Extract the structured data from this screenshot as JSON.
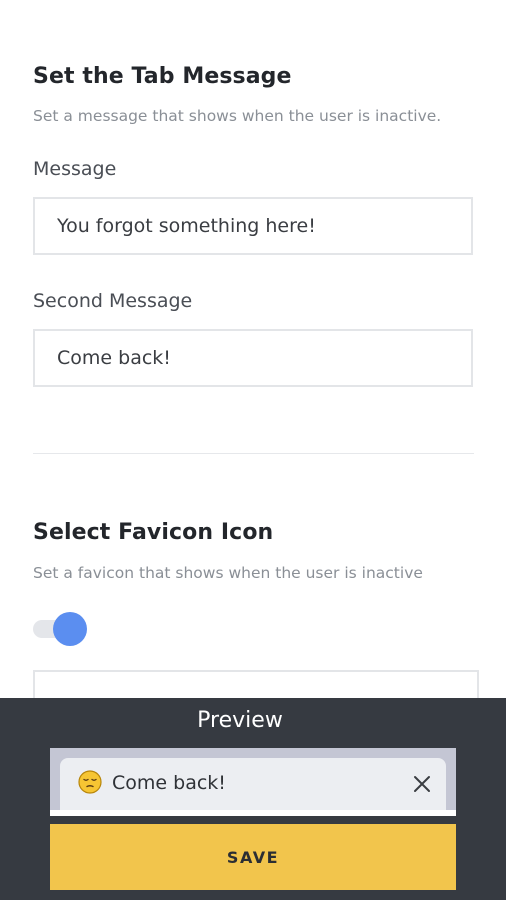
{
  "tab_message": {
    "title": "Set the Tab Message",
    "description": "Set a message that shows when the user is inactive.",
    "message_label": "Message",
    "message_value": "You forgot something here!",
    "second_message_label": "Second Message",
    "second_message_value": "Come back!"
  },
  "favicon": {
    "title": "Select Favicon Icon",
    "description": "Set a favicon that shows when the user is inactive",
    "toggle_on": true,
    "toggle_color": "#5b8ef0"
  },
  "preview": {
    "title": "Preview",
    "tab_icon": "pensive-face-emoji-icon",
    "tab_label": "Come back!",
    "close_icon": "close-icon"
  },
  "save": {
    "label": "SAVE",
    "color": "#f2c54c"
  },
  "colors": {
    "preview_bg": "#363a41",
    "tab_strip": "#c4c6d4"
  }
}
